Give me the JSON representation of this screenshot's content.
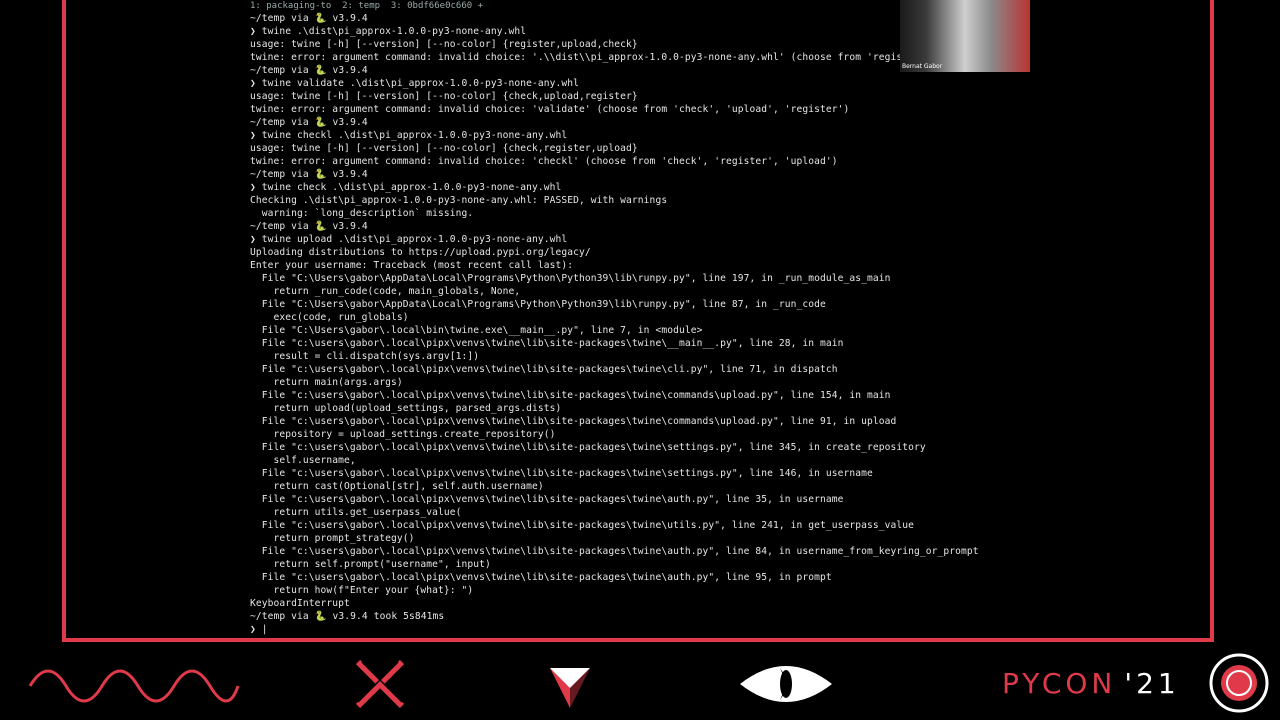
{
  "terminal": {
    "tabs": "1: packaging-to  2: temp  3: 0bdf66e0c660 +",
    "lines": [
      "~/temp via 🐍 v3.9.4",
      "❯ twine .\\dist\\pi_approx-1.0.0-py3-none-any.whl",
      "usage: twine [-h] [--version] [--no-color] {register,upload,check}",
      "twine: error: argument command: invalid choice: '.\\\\dist\\\\pi_approx-1.0.0-py3-none-any.whl' (choose from 'register'",
      "~/temp via 🐍 v3.9.4",
      "❯ twine validate .\\dist\\pi_approx-1.0.0-py3-none-any.whl",
      "usage: twine [-h] [--version] [--no-color] {check,upload,register}",
      "twine: error: argument command: invalid choice: 'validate' (choose from 'check', 'upload', 'register')",
      "~/temp via 🐍 v3.9.4",
      "❯ twine checkl .\\dist\\pi_approx-1.0.0-py3-none-any.whl",
      "usage: twine [-h] [--version] [--no-color] {check,register,upload}",
      "twine: error: argument command: invalid choice: 'checkl' (choose from 'check', 'register', 'upload')",
      "~/temp via 🐍 v3.9.4",
      "❯ twine check .\\dist\\pi_approx-1.0.0-py3-none-any.whl",
      "Checking .\\dist\\pi_approx-1.0.0-py3-none-any.whl: PASSED, with warnings",
      "  warning: `long_description` missing.",
      "~/temp via 🐍 v3.9.4",
      "❯ twine upload .\\dist\\pi_approx-1.0.0-py3-none-any.whl",
      "Uploading distributions to https://upload.pypi.org/legacy/",
      "Enter your username: Traceback (most recent call last):",
      "  File \"C:\\Users\\gabor\\AppData\\Local\\Programs\\Python\\Python39\\lib\\runpy.py\", line 197, in _run_module_as_main",
      "    return _run_code(code, main_globals, None,",
      "  File \"C:\\Users\\gabor\\AppData\\Local\\Programs\\Python\\Python39\\lib\\runpy.py\", line 87, in _run_code",
      "    exec(code, run_globals)",
      "  File \"C:\\Users\\gabor\\.local\\bin\\twine.exe\\__main__.py\", line 7, in <module>",
      "  File \"c:\\users\\gabor\\.local\\pipx\\venvs\\twine\\lib\\site-packages\\twine\\__main__.py\", line 28, in main",
      "    result = cli.dispatch(sys.argv[1:])",
      "  File \"c:\\users\\gabor\\.local\\pipx\\venvs\\twine\\lib\\site-packages\\twine\\cli.py\", line 71, in dispatch",
      "    return main(args.args)",
      "  File \"c:\\users\\gabor\\.local\\pipx\\venvs\\twine\\lib\\site-packages\\twine\\commands\\upload.py\", line 154, in main",
      "    return upload(upload_settings, parsed_args.dists)",
      "  File \"c:\\users\\gabor\\.local\\pipx\\venvs\\twine\\lib\\site-packages\\twine\\commands\\upload.py\", line 91, in upload",
      "    repository = upload_settings.create_repository()",
      "  File \"c:\\users\\gabor\\.local\\pipx\\venvs\\twine\\lib\\site-packages\\twine\\settings.py\", line 345, in create_repository",
      "    self.username,",
      "  File \"c:\\users\\gabor\\.local\\pipx\\venvs\\twine\\lib\\site-packages\\twine\\settings.py\", line 146, in username",
      "    return cast(Optional[str], self.auth.username)",
      "  File \"c:\\users\\gabor\\.local\\pipx\\venvs\\twine\\lib\\site-packages\\twine\\auth.py\", line 35, in username",
      "    return utils.get_userpass_value(",
      "  File \"c:\\users\\gabor\\.local\\pipx\\venvs\\twine\\lib\\site-packages\\twine\\utils.py\", line 241, in get_userpass_value",
      "    return prompt_strategy()",
      "  File \"c:\\users\\gabor\\.local\\pipx\\venvs\\twine\\lib\\site-packages\\twine\\auth.py\", line 84, in username_from_keyring_or_prompt",
      "    return self.prompt(\"username\", input)",
      "  File \"c:\\users\\gabor\\.local\\pipx\\venvs\\twine\\lib\\site-packages\\twine\\auth.py\", line 95, in prompt",
      "    return how(f\"Enter your {what}: \")",
      "KeyboardInterrupt",
      "~/temp via 🐍 v3.9.4 took 5s841ms",
      "❯ |"
    ]
  },
  "webcam": {
    "label": "Bernat Gabor"
  },
  "branding": {
    "pycon": "PYCON",
    "year": "'21"
  },
  "colors": {
    "accent": "#e03a4a",
    "background": "#000000",
    "text": "#e6e6e6"
  },
  "icons": [
    "wave-icon",
    "x-mark-icon",
    "triangle-logo-icon",
    "eye-icon",
    "pycon-circle-icon"
  ]
}
